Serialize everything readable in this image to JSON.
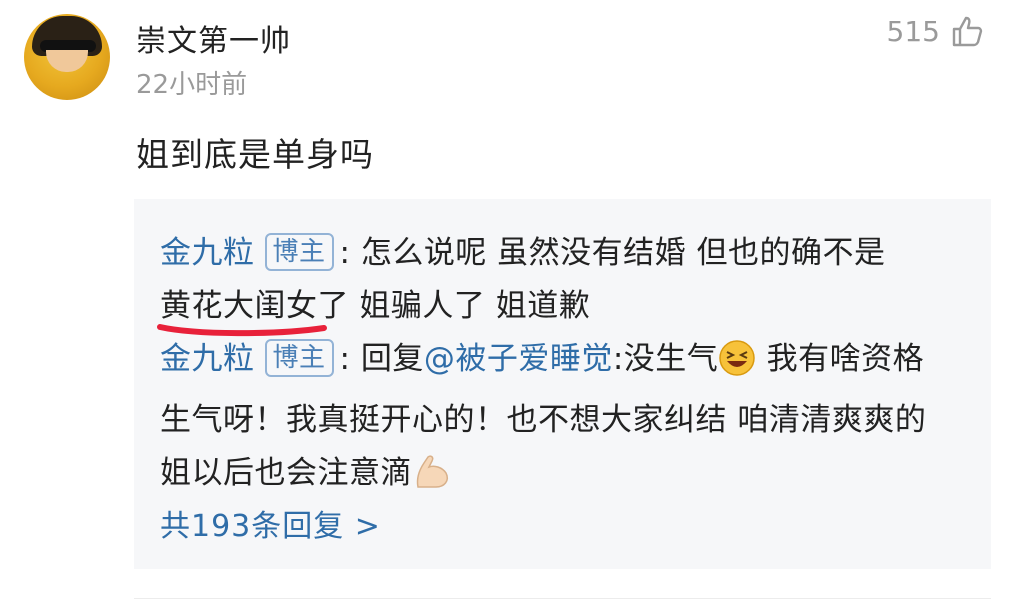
{
  "post": {
    "username": "崇文第一帅",
    "timestamp": "22小时前",
    "like_count": "515",
    "comment_text": "姐到底是单身吗"
  },
  "replies": [
    {
      "author": "金九粒",
      "badge": "博主",
      "sep": ":",
      "text_a": "怎么说呢 虽然没有结婚 但也的确不是",
      "text_highlight": "黄花大闺女",
      "text_b": "了 姐骗人了 姐道歉"
    },
    {
      "author": "金九粒",
      "badge": "博主",
      "sep": ":",
      "prefix": "回复",
      "mention": "@被子爱睡觉",
      "text_a": ":没生气",
      "text_b": "我有啥资格生气呀！我真挺开心的！也不想大家纠结 咱清清爽爽的 姐以后也会注意滴"
    }
  ],
  "more_replies": "共193条回复 >",
  "colors": {
    "link": "#2f6da8",
    "muted": "#9a9a9a",
    "reply_bg": "#f6f7f9",
    "underline": "#e8213a"
  },
  "icons": [
    "thumbs-up-icon",
    "grinning-squint-emoji",
    "flexed-biceps-emoji"
  ]
}
